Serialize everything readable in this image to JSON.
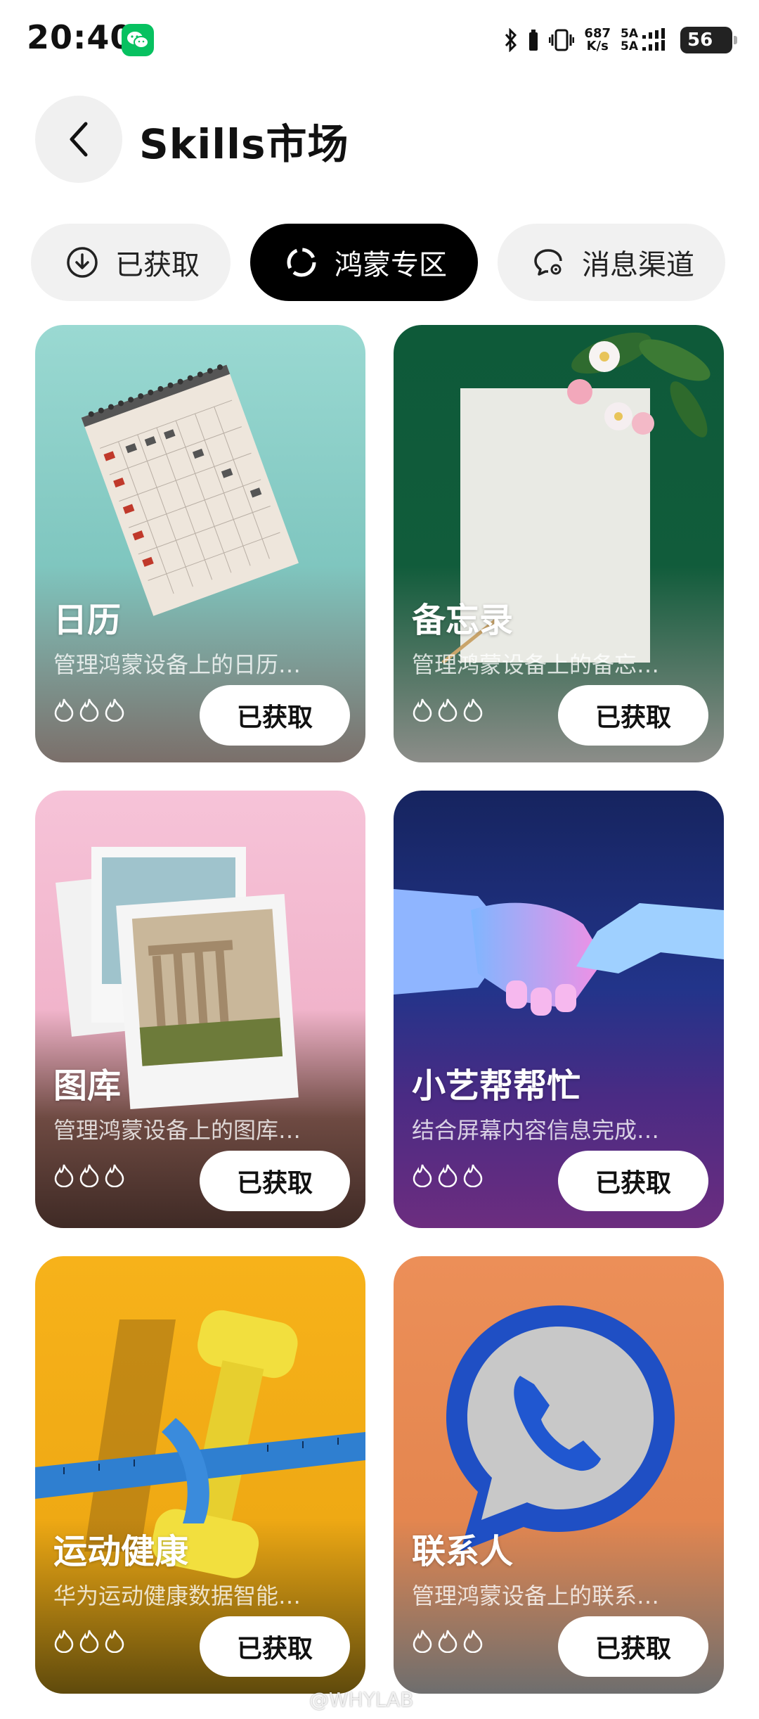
{
  "status_bar": {
    "time": "20:40",
    "net_speed_top": "687",
    "net_speed_bottom": "K/s",
    "sim1": "5A",
    "sim2": "5A",
    "battery": "56"
  },
  "header": {
    "title": "Skills市场"
  },
  "tabs": [
    {
      "label": "已获取",
      "icon": "download-circle-icon",
      "active": false
    },
    {
      "label": "鸿蒙专区",
      "icon": "harmony-ring-icon",
      "active": true
    },
    {
      "label": "消息渠道",
      "icon": "chat-settings-icon",
      "active": false
    }
  ],
  "cards": [
    {
      "name": "日历",
      "desc": "管理鸿蒙设备上的日历…",
      "button": "已获取",
      "theme_color": "#8fd3cd",
      "bottom_color": "#8a7770"
    },
    {
      "name": "备忘录",
      "desc": "管理鸿蒙设备上的备忘…",
      "button": "已获取",
      "theme_color": "#0f5f3c",
      "bottom_color": "#8b8c88"
    },
    {
      "name": "图库",
      "desc": "管理鸿蒙设备上的图库…",
      "button": "已获取",
      "theme_color": "#f6bfd6",
      "bottom_color": "#4a2f2a"
    },
    {
      "name": "小艺帮帮忙",
      "desc": "结合屏幕内容信息完成…",
      "button": "已获取",
      "theme_color": "#1c2f7a",
      "bottom_color": "#6a2a7e"
    },
    {
      "name": "运动健康",
      "desc": "华为运动健康数据智能…",
      "button": "已获取",
      "theme_color": "#f5b01a",
      "bottom_color": "#6b5410"
    },
    {
      "name": "联系人",
      "desc": "管理鸿蒙设备上的联系…",
      "button": "已获取",
      "theme_color": "#ea8c56",
      "bottom_color": "#6f6e6e"
    }
  ],
  "watermark": "@WHYLAB"
}
